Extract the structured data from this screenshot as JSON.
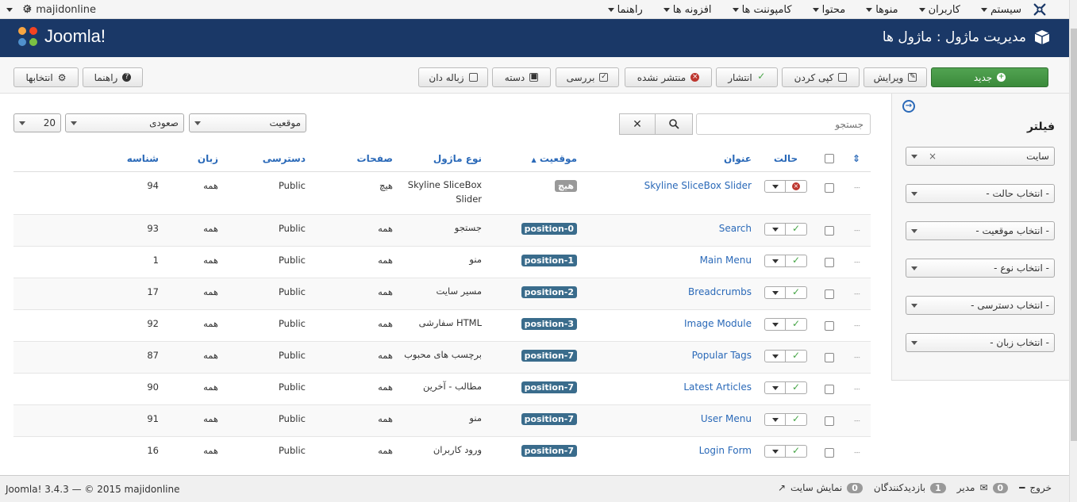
{
  "topnav": {
    "menu": [
      "سیستم",
      "کاربران",
      "منوها",
      "محتوا",
      "کامپوننت ها",
      "افزونه ها",
      "راهنما"
    ],
    "site_link": "majidonline",
    "gear": "gear-icon"
  },
  "header": {
    "brand": "Joomla!",
    "title": "مدیریت ماژول : ماژول ها"
  },
  "toolbar": {
    "new": "جدید",
    "edit": "ویرایش",
    "copy": "کپی کردن",
    "publish": "انتشار",
    "unpublish": "منتشر نشده",
    "checkin": "بررسی",
    "batch": "دسته",
    "trash": "زباله دان",
    "help": "راهنما",
    "options": "انتخابها"
  },
  "search": {
    "placeholder": "جستجو"
  },
  "filters": {
    "position": "موقعیت",
    "order": "صعودی",
    "limit": "20"
  },
  "sidebar": {
    "title": "فیلتر",
    "selects": [
      "سایت",
      "- انتخاب حالت -",
      "- انتخاب موقعیت -",
      "- انتخاب نوع -",
      "- انتخاب دسترسی -",
      "- انتخاب زبان -"
    ]
  },
  "table": {
    "headers": {
      "status": "حالت",
      "title": "عنوان",
      "position": "موقعیت",
      "type": "نوع ماژول",
      "pages": "صفحات",
      "access": "دسترسی",
      "language": "زبان",
      "id": "شناسه"
    },
    "rows": [
      {
        "title": "Skyline SliceBox Slider",
        "position": "هیچ",
        "type": "Skyline SliceBox Slider",
        "pages": "هیچ",
        "access": "Public",
        "language": "همه",
        "id": "94",
        "published": false
      },
      {
        "title": "Search",
        "position": "position-0",
        "type": "جستجو",
        "pages": "همه",
        "access": "Public",
        "language": "همه",
        "id": "93",
        "published": true
      },
      {
        "title": "Main Menu",
        "position": "position-1",
        "type": "منو",
        "pages": "همه",
        "access": "Public",
        "language": "همه",
        "id": "1",
        "published": true
      },
      {
        "title": "Breadcrumbs",
        "position": "position-2",
        "type": "مسیر سایت",
        "pages": "همه",
        "access": "Public",
        "language": "همه",
        "id": "17",
        "published": true
      },
      {
        "title": "Image Module",
        "position": "position-3",
        "type": "HTML سفارشی",
        "pages": "همه",
        "access": "Public",
        "language": "همه",
        "id": "92",
        "published": true
      },
      {
        "title": "Popular Tags",
        "position": "position-7",
        "type": "برچسب های محبوب",
        "pages": "همه",
        "access": "Public",
        "language": "همه",
        "id": "87",
        "published": true
      },
      {
        "title": "Latest Articles",
        "position": "position-7",
        "type": "مطالب - آخرین",
        "pages": "همه",
        "access": "Public",
        "language": "همه",
        "id": "90",
        "published": true
      },
      {
        "title": "User Menu",
        "position": "position-7",
        "type": "منو",
        "pages": "همه",
        "access": "Public",
        "language": "همه",
        "id": "91",
        "published": true
      },
      {
        "title": "Login Form",
        "position": "position-7",
        "type": "ورود کاربران",
        "pages": "همه",
        "access": "Public",
        "language": "همه",
        "id": "16",
        "published": true
      }
    ]
  },
  "footer": {
    "left": "Joomla! 3.4.3 — © 2015 majidonline",
    "view_site": "نمایش سایت",
    "visitors_count": "0",
    "visitors": "بازدیدکنندگان",
    "admins_count": "1",
    "admin": "مدیر",
    "messages_count": "0",
    "logout": "خروج"
  }
}
